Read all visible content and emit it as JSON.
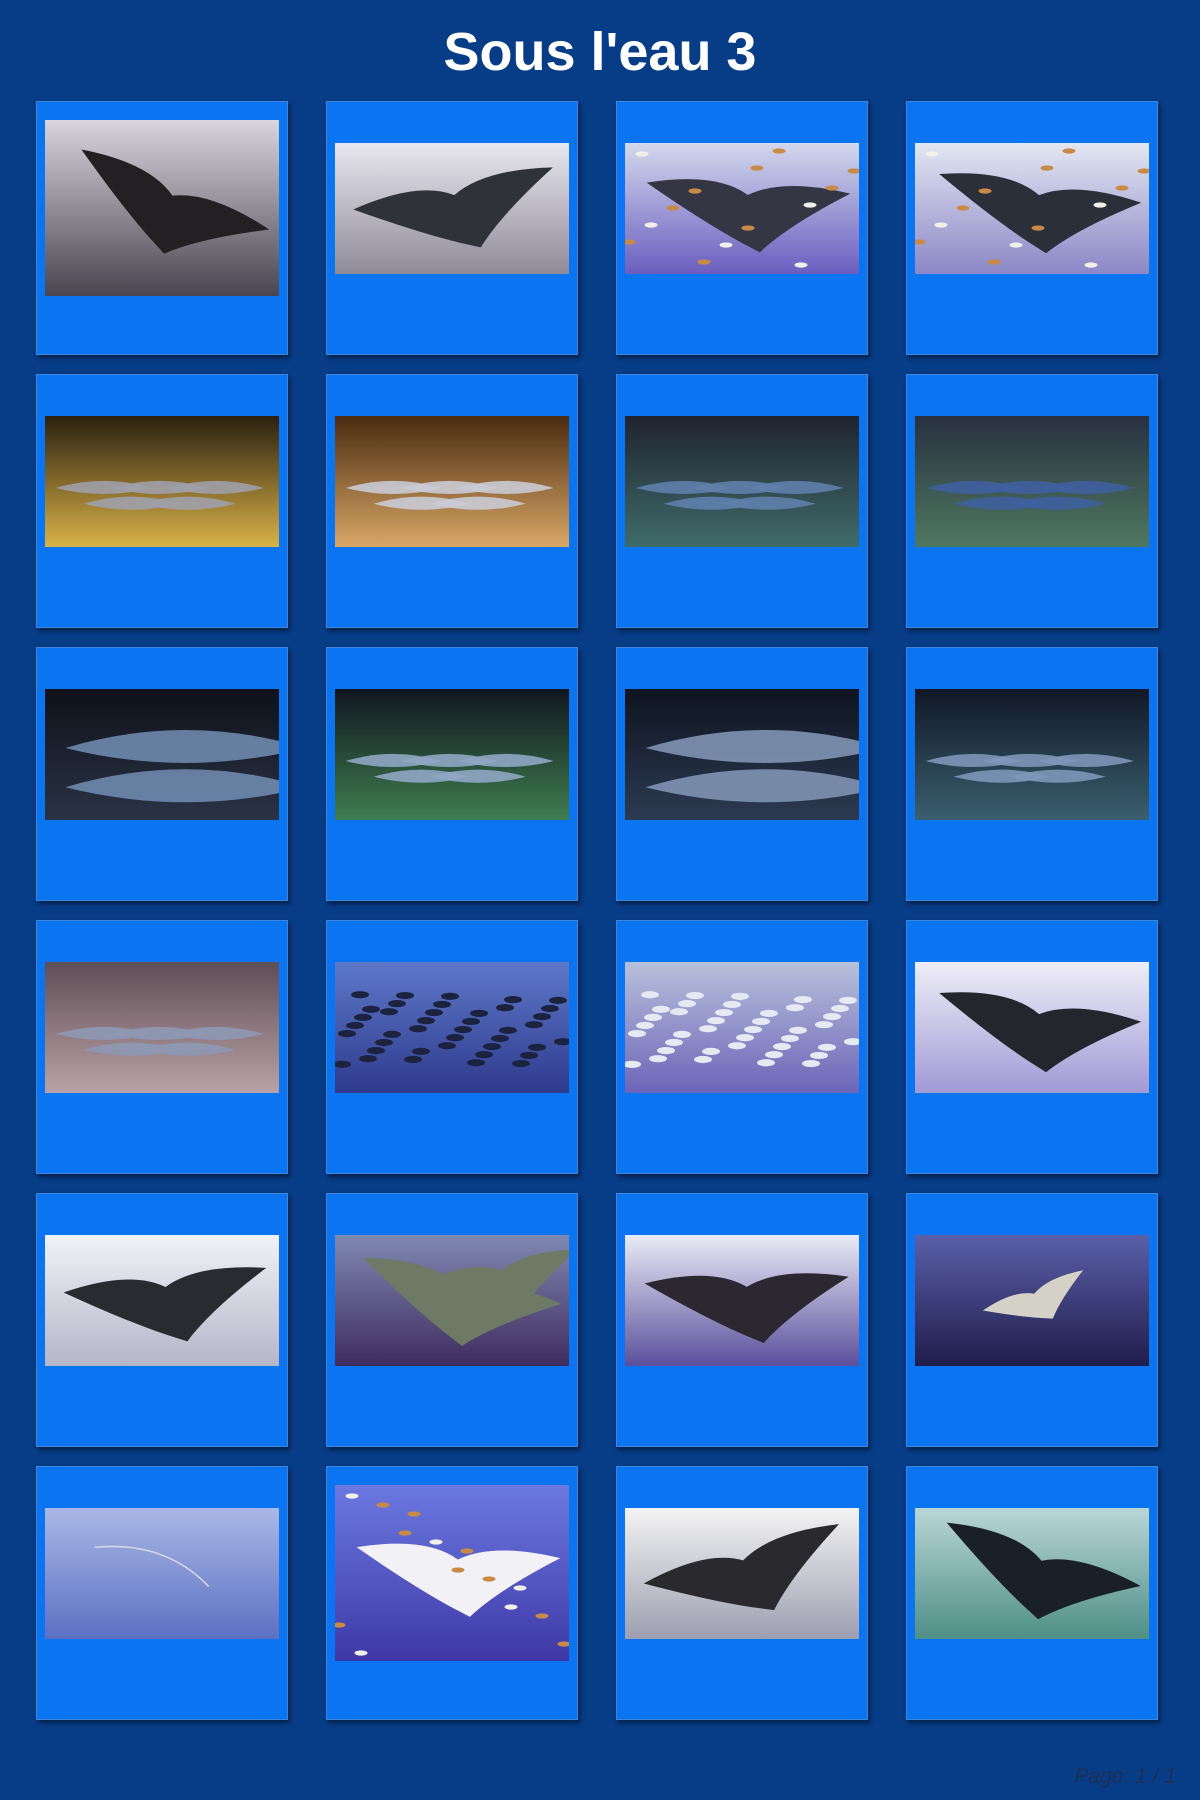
{
  "title": "Sous l'eau 3",
  "footer": "Page: 1 / 1",
  "photos": [
    {
      "subject": "manta-ray",
      "bg": [
        "#d9d5de",
        "#4a4550"
      ],
      "fg": "#241f22",
      "portrait": true
    },
    {
      "subject": "manta-ray",
      "bg": [
        "#e8e7ef",
        "#8f8b99"
      ],
      "fg": "#2f3238",
      "portrait": false
    },
    {
      "subject": "manta-ray-with-fish",
      "bg": [
        "#d3d8ec",
        "#6b5ec0"
      ],
      "fg": "#343743",
      "portrait": false
    },
    {
      "subject": "manta-ray-with-fish",
      "bg": [
        "#e3e7f2",
        "#8b87c6"
      ],
      "fg": "#2b2f3a",
      "portrait": false
    },
    {
      "subject": "sharks-in-cave",
      "bg": [
        "#2a2010",
        "#d9b247"
      ],
      "fg": "#9ea0a8",
      "portrait": false
    },
    {
      "subject": "sharks-in-cave",
      "bg": [
        "#4a2b10",
        "#d9a766"
      ],
      "fg": "#c9cbd4",
      "portrait": false
    },
    {
      "subject": "sharks-on-reef",
      "bg": [
        "#1f2330",
        "#3f6b6a"
      ],
      "fg": "#5f7fab",
      "portrait": false
    },
    {
      "subject": "sharks-on-reef",
      "bg": [
        "#283040",
        "#4f7860"
      ],
      "fg": "#3f5f9e",
      "portrait": false
    },
    {
      "subject": "shark-closeup",
      "bg": [
        "#0e111a",
        "#2a3345"
      ],
      "fg": "#6f88ad",
      "portrait": false
    },
    {
      "subject": "sharks-resting",
      "bg": [
        "#10161f",
        "#3f7d4f"
      ],
      "fg": "#8fa6c3",
      "portrait": false
    },
    {
      "subject": "shark-closeup",
      "bg": [
        "#0e1420",
        "#2c3a52"
      ],
      "fg": "#7f93b2",
      "portrait": false
    },
    {
      "subject": "sharks-resting",
      "bg": [
        "#111726",
        "#3a5f6f"
      ],
      "fg": "#7e96b8",
      "portrait": false
    },
    {
      "subject": "sharks-on-reef",
      "bg": [
        "#5f4d55",
        "#b9a2a7"
      ],
      "fg": "#8e98b2",
      "portrait": false
    },
    {
      "subject": "fish-school",
      "bg": [
        "#5d78c8",
        "#2f3a8c"
      ],
      "fg": "#1c2340",
      "portrait": false
    },
    {
      "subject": "fish-school",
      "bg": [
        "#b8c1db",
        "#6c64b8"
      ],
      "fg": "#e5e9f2",
      "portrait": false
    },
    {
      "subject": "manta-ray",
      "bg": [
        "#efeef7",
        "#a09ad6"
      ],
      "fg": "#24262d",
      "portrait": false
    },
    {
      "subject": "manta-ray",
      "bg": [
        "#f1f2f7",
        "#b6b5c9"
      ],
      "fg": "#2a2b30",
      "portrait": false
    },
    {
      "subject": "manta-pair",
      "bg": [
        "#7f89b1",
        "#3f2c5e"
      ],
      "fg": "#6e7a66",
      "portrait": false
    },
    {
      "subject": "manta-ray",
      "bg": [
        "#e9ebf5",
        "#5b4f9c"
      ],
      "fg": "#2b2831",
      "portrait": false
    },
    {
      "subject": "manta-ray-small",
      "bg": [
        "#5a5fa8",
        "#201d4c"
      ],
      "fg": "#d4d1c6",
      "portrait": false
    },
    {
      "subject": "open-water",
      "bg": [
        "#a9b8e6",
        "#5c70c2"
      ],
      "fg": "#d7d9e2",
      "portrait": false
    },
    {
      "subject": "manta-ray-with-fish",
      "bg": [
        "#6b79e0",
        "#3e38a6"
      ],
      "fg": "#f2f2f6",
      "portrait": true
    },
    {
      "subject": "manta-ray",
      "bg": [
        "#f3f3f2",
        "#9d9fb1"
      ],
      "fg": "#2a2a2e",
      "portrait": false
    },
    {
      "subject": "manta-ray",
      "bg": [
        "#b9d6d6",
        "#4e8f86"
      ],
      "fg": "#1a2028",
      "portrait": false
    }
  ]
}
